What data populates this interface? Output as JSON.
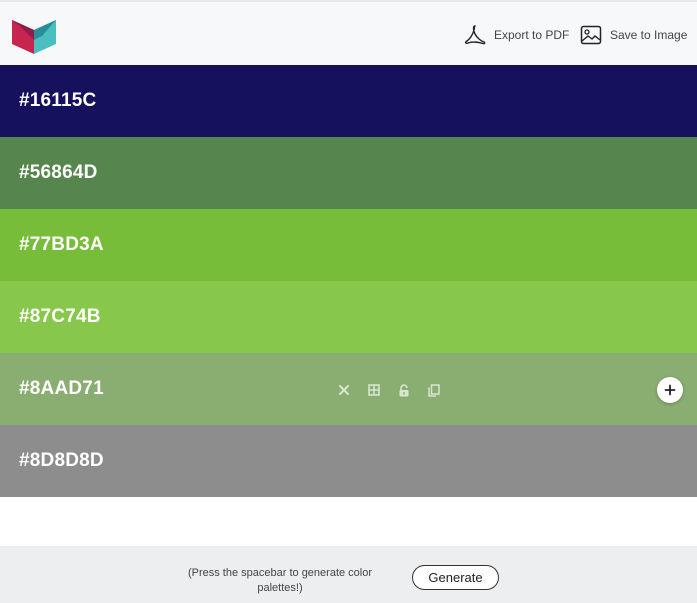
{
  "header": {
    "logo_icon": "cube-logo-icon",
    "export_pdf_label": "Export to PDF",
    "export_pdf_icon": "pdf-icon",
    "save_image_label": "Save to Image",
    "save_image_icon": "image-icon"
  },
  "palette": {
    "swatches": [
      {
        "hex": "#16115C",
        "color": "#16115C"
      },
      {
        "hex": "#56864D",
        "color": "#56864D"
      },
      {
        "hex": "#77BD3A",
        "color": "#77BD3A"
      },
      {
        "hex": "#87C74B",
        "color": "#87C74B"
      },
      {
        "hex": "#8AAD71",
        "color": "#8AAD71"
      },
      {
        "hex": "#8D8D8D",
        "color": "#8D8D8D"
      }
    ],
    "hovered_index": 4,
    "swatch_tools": [
      "close-icon",
      "grid-icon",
      "lock-open-icon",
      "copy-icon"
    ],
    "add_icon": "plus-icon"
  },
  "footer": {
    "hint_text": "(Press the spacebar to generate color palettes!)",
    "generate_label": "Generate"
  }
}
